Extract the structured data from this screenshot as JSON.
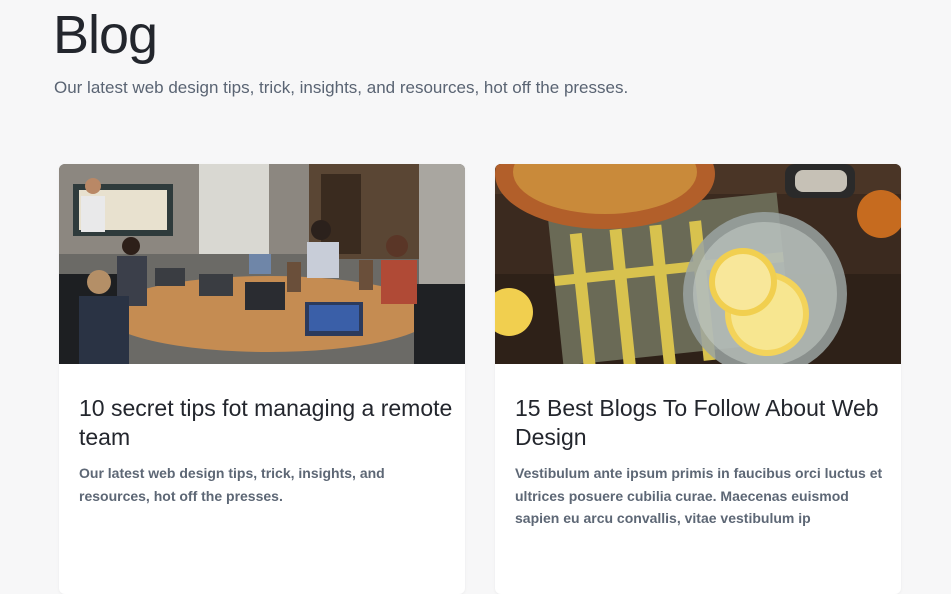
{
  "header": {
    "title": "Blog",
    "subtitle": "Our latest web design tips, trick, insights, and resources, hot off the presses."
  },
  "posts": [
    {
      "title": "10 secret tips fot managing a remote team",
      "excerpt": "Our latest web design tips, trick, insights, and resources, hot off the presses.",
      "image": "office-meeting-photo"
    },
    {
      "title": "15 Best Blogs To Follow About Web Design",
      "excerpt": "Vestibulum ante ipsum primis in faucibus orci luctus et ultrices posuere cubilia curae. Maecenas euismod sapien eu arcu convallis, vitae vestibulum ip",
      "image": "lemon-water-jar-photo"
    }
  ]
}
